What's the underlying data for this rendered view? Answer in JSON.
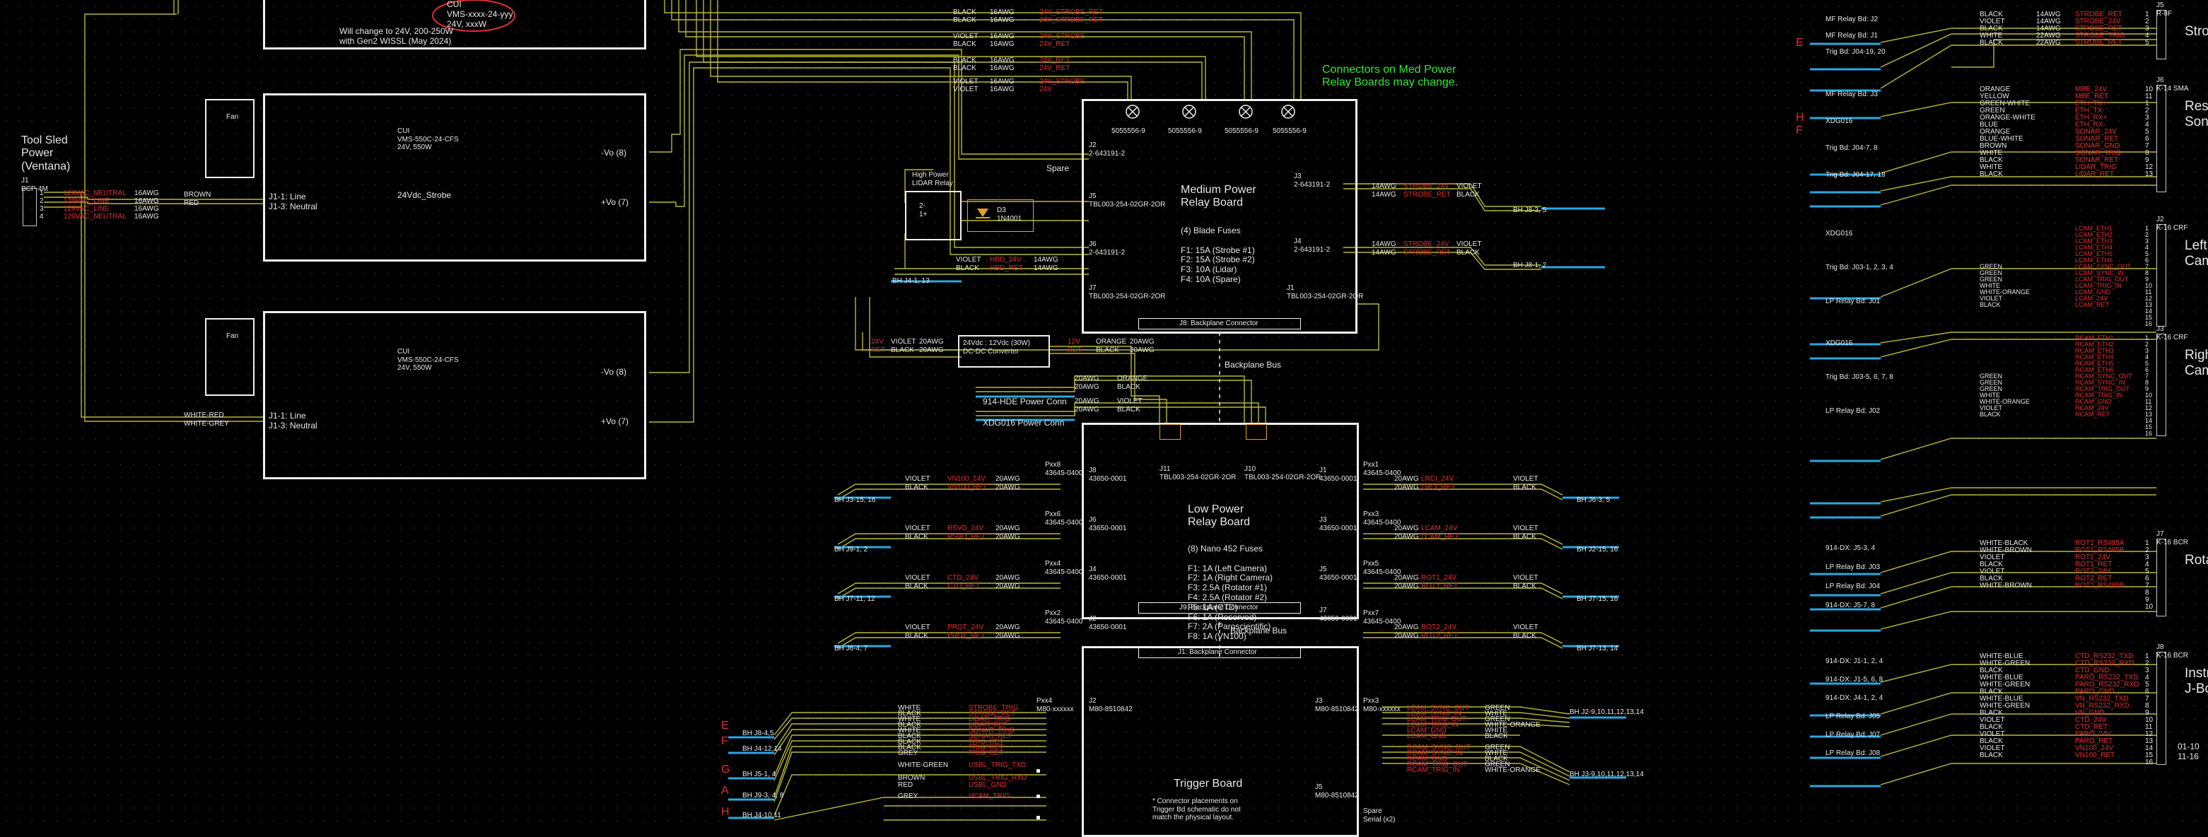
{
  "tool_sled": {
    "title": "Tool Sled\nPower\n(Ventana)",
    "connector": "J1\nBCP-4M"
  },
  "tool_sled_wires": {
    "signals": [
      "120VAC_NEUTRAL",
      "120VAC_LINE",
      "120VAC_LINE",
      "120VAC_NEUTRAL"
    ],
    "gauges": [
      "16AWG",
      "16AWG",
      "16AWG",
      "16AWG"
    ],
    "pins": [
      "1",
      "2",
      "3",
      "4"
    ]
  },
  "note_top": {
    "cui_name": "CUI\nVMS-xxxx-24-yyy\n24V, xxxW",
    "change_text": "Will change to 24V, 200-250W\nwith Gen2 WISSL (May 2024)"
  },
  "psu1": {
    "fan": "Fan",
    "cui": "CUI\nVMS-550C-24-CFS\n24V, 550W",
    "name": "24Vdc_Strobe",
    "j1": "J1-1: Line\nJ1-3: Neutral",
    "vminus": "-Vo (8)",
    "vplus": "+Vo (7)",
    "wire_colors": "BROWN\nRED"
  },
  "psu2": {
    "fan": "Fan",
    "cui": "CUI\nVMS-550C-24-CFS\n24V, 550W",
    "j1": "J1-1: Line\nJ1-3: Neutral",
    "vminus": "-Vo (8)",
    "vplus": "+Vo (7)",
    "wire_colors": "WHITE-RED\nWHITE-GREY"
  },
  "top_bundle": {
    "colors": [
      "BLACK",
      "BLACK",
      "VIOLET",
      "BLACK",
      "BLACK",
      "BLACK",
      "VIOLET",
      "VIOLET"
    ],
    "gauges": [
      "16AWG",
      "16AWG",
      "16AWG",
      "16AWG",
      "16AWG",
      "16AWG",
      "16AWG",
      "16AWG"
    ],
    "signals": [
      "24V_STROBE_RET",
      "24V_STROBE_RET",
      "24V_STROBE",
      "24V_RET",
      "24V_RET",
      "24V_RET",
      "24V_STROBE",
      "24V"
    ]
  },
  "med_note": "Connectors on Med Power\nRelay Boards may change.",
  "mpr": {
    "title": "Medium Power\nRelay Board",
    "connectors": [
      "5055556-9",
      "5055556-9",
      "5055556-9",
      "5055556-9"
    ],
    "fuses": "(4) Blade Fuses\n\nF1: 15A (Strobe #1)\nF2: 15A (Strobe #2)\nF3: 10A (Lidar)\nF4: 10A (Spare)",
    "backplane": "J8: Backplane Connector",
    "spare": "Spare",
    "j_left1": "J2\n2-643191-2",
    "j_left2": "J5\nTBL003-254-02GR-2OR",
    "j_left3": "J6\n2-643191-2",
    "j_left4": "J7\nTBL003-254-02GR-2OR",
    "j_right1": "J3\n2-643191-2",
    "j_right2": "J4\n2-643191-2",
    "j_right3": "J1\nTBL003-254-02GR-2OR"
  },
  "mpr_outputs": {
    "out1": {
      "gauges": "14AWG\n14AWG",
      "signals": "STROBE_24V\nSTROBE_RET",
      "colors": "VIOLET\nBLACK",
      "dest": "BH J8-3, 5"
    },
    "out2": {
      "gauges": "14AWG\n14AWG",
      "signals": "STROBE_24V\nSTROBE_RET",
      "colors": "VIOLET\nBLACK",
      "dest": "BH J8-1, 2"
    }
  },
  "lidar": {
    "title": "High Power\nLIDAR Relay",
    "pins": "2-\n1+",
    "diode": "D3\n1N4001"
  },
  "lidar_wires": {
    "colors": "VIOLET\nBLACK",
    "signals": "HBD_24V\nHBD_RET",
    "gauges": "14AWG\n14AWG",
    "dest": "BH J4-1, 13"
  },
  "dcdc": {
    "label": "24Vdc : 12Vdc (30W)\nDC-DC Converter",
    "left": "24V\nRET",
    "left_colors": "VIOLET\nBLACK",
    "left_gauges": "20AWG\n20AWG",
    "right": "12V\nRET",
    "right_colors": "ORANGE\nBLACK",
    "right_gauges": "20AWG\n20AWG"
  },
  "backplane_bus_1": "Backplane Bus",
  "backplane_bus_2": "Backplane Bus",
  "power_conns": {
    "c1": {
      "label": "914-HDE Power Conn",
      "gauges": "20AWG\n20AWG",
      "colors": "ORANGE\nBLACK"
    },
    "c2": {
      "label": "XDG016 Power Conn",
      "gauges": "20AWG\n20AWG",
      "colors": "VIOLET\nBLACK"
    }
  },
  "lpr": {
    "title": "Low Power\nRelay Board",
    "fuses": "(8) Nano 452 Fuses\n\nF1: 1A (Left Camera)\nF2: 1A (Right Camera)\nF3: 2.5A (Rotator #1)\nF4: 2.5A (Rotator #2)\nF5: 1A (CTD)\nF6: 1A (Reserved)\nF7: 2A (Paroscientific)\nF8: 1A (VN100)",
    "backplane": "J9: Backplane Connector",
    "j11": "J11\nTBL003-254-02GR-2OR",
    "j10": "J10\nTBL003-254-02GR-2OR",
    "left_j": [
      "J8\n43650-0001",
      "J6\n43650-0001",
      "J4\n43650-0001",
      "J2\n43650-0001"
    ],
    "right_j": [
      "J1\n43650-0001",
      "J3\n43650-0001",
      "J5\n43650-0001",
      "J7\n43650-0001"
    ],
    "left_p": [
      "Pxx8\n43645-0400",
      "Pxx6\n43645-0400",
      "Pxx4\n43645-0400",
      "Pxx2\n43645-0400"
    ],
    "right_p": [
      "Pxx1\n43645-0400",
      "Pxx3\n43645-0400",
      "Pxx5\n43645-0400",
      "Pxx7\n43645-0400"
    ]
  },
  "lpr_left": [
    {
      "colors": "VIOLET\nBLACK",
      "signals": "VN100_24V\nVN100_RET",
      "gauges": "20AWG\n20AWG",
      "dest": "BH J3-15, 16"
    },
    {
      "colors": "VIOLET\nBLACK",
      "signals": "RSVD_24V\nRSVD_RET",
      "gauges": "20AWG\n20AWG",
      "dest": "BH J9-1, 2"
    },
    {
      "colors": "VIOLET\nBLACK",
      "signals": "CTD_24V\nCTD_RET",
      "gauges": "20AWG\n20AWG",
      "dest": "BH J7-11, 12"
    },
    {
      "colors": "VIOLET\nBLACK",
      "signals": "PROT_24V\nPROT_RET",
      "gauges": "20AWG\n20AWG",
      "dest": "BH J6-4, 7"
    }
  ],
  "lpr_right": [
    {
      "colors": "VIOLET\nBLACK",
      "signals": "LRCI_24V\nLRCI_RET",
      "gauges": "20AWG\n20AWG",
      "dest": "BH J6-3, 5"
    },
    {
      "colors": "VIOLET\nBLACK",
      "signals": "LCAM_24V\nLCAM_RET",
      "gauges": "20AWG\n20AWG",
      "dest": "BH J2-15, 16"
    },
    {
      "colors": "VIOLET\nBLACK",
      "signals": "ROT1_24V\nROT1_RET",
      "gauges": "20AWG\n20AWG",
      "dest": "BH J7-15, 16"
    },
    {
      "colors": "VIOLET\nBLACK",
      "signals": "ROT2_24V\nROT2_RET",
      "gauges": "20AWG\n20AWG",
      "dest": "BH J7-13, 14"
    }
  ],
  "trigger": {
    "title": "Trigger Board",
    "backplane": "J1: Backplane Connector",
    "note": "* Connector placements on\nTrigger Bd schematic do not\nmatch the physical layout.",
    "j2": "J2\nM80-8510842",
    "j3": "J3\nM80-8510842",
    "j5": "J5\nM80-8510842",
    "pxx4": "Pxx4\nM80-xxxxxx",
    "pxx3": "Pxx3\nM80-xxxxxx",
    "spare": "Spare\nSerial (x2)"
  },
  "trigger_left": {
    "letters": [
      "E",
      "F",
      "G",
      "A",
      "H"
    ],
    "dests": [
      "BH J8-4,5",
      "BH J4-12,14",
      "BH J5-1, 4",
      "BH J9-3, 4, 8",
      "BH J4-10,11"
    ],
    "colors": [
      "WHITE",
      "BLACK",
      "WHITE",
      "BLACK",
      "WHITE",
      "BLACK",
      "BLACK",
      "BLACK",
      "GREY",
      "WHITE-GREEN",
      "BROWN",
      "RED",
      "GREY"
    ],
    "signals": [
      "STROBE_TRIG",
      "STROBE_RET",
      "LIDAR_TRIG",
      "LIDAR_RET",
      "SONAR_TRIG",
      "SONAR_RET",
      "TRIG_RET",
      "TRIG_RET",
      "TRIG_RET",
      "USBL_TRIG_TXD",
      "USBL_TRIG_RXD",
      "USBL_GND",
      "VCAM_TRIG"
    ]
  },
  "trigger_right": {
    "dests": [
      "BH J2-9,10,11,12,13,14",
      "BH J3-9,10,11,12,13,14"
    ],
    "colors": [
      "GREEN",
      "WHITE",
      "GREEN",
      "WHITE-ORANGE",
      "WHITE",
      "BLACK",
      "GREEN",
      "WHITE",
      "BLACK",
      "GREEN",
      "WHITE-ORANGE"
    ],
    "signals": [
      "LCAM_SYNC_OUT",
      "LCAM_SYNC_IN",
      "LCAM_TRIG_OUT",
      "LCAM_TRIG_IN",
      "LCAM_GND",
      "LCAM_GND",
      "RCAM_SYNC_OUT",
      "RCAM_SYNC_IN",
      "RCAM_GND",
      "RCAM_TRIG_OUT",
      "RCAM_TRIG_IN"
    ]
  },
  "right_panel": {
    "sections": [
      {
        "title": "Strob",
        "connector": "J5\nR-8F",
        "srcs": [
          "MF Relay Bd: J2",
          "MF Relay Bd: J1",
          "Trig Bd: J04-19, 20"
        ],
        "letter": "E",
        "colors": [
          "BLACK",
          "VIOLET",
          "BLACK",
          "WHITE",
          "BLACK"
        ],
        "gauges": [
          "14AWG",
          "14AWG",
          "14AWG",
          "22AWG",
          "22AWG"
        ],
        "signals": [
          "STROBE_RET",
          "STROBE_24V",
          "STROBE_RET",
          "STROBE_TRIG",
          "STROBE_RET"
        ],
        "pins": [
          "1",
          "2",
          "3",
          "4",
          "5"
        ]
      },
      {
        "title": "Reso\nSona",
        "connector": "J6\nK-14 SMA",
        "srcs": [
          "MF Relay Bd: J3",
          "XDG016",
          "Trig Bd: J04-7, 8",
          "Trig Bd: J04-17, 18"
        ],
        "letter": "H\nF",
        "colors": [
          "ORANGE",
          "YELLOW",
          "GREEN-WHITE",
          "GREEN",
          "ORANGE-WHITE",
          "BLUE",
          "ORANGE",
          "BLUE-WHITE",
          "BROWN",
          "WHITE",
          "BLACK",
          "WHITE",
          "BLACK"
        ],
        "signals": [
          "MBE_24V",
          "MBE_RET",
          "ETH_TX+",
          "ETH_TX-",
          "ETH_RX+",
          "ETH_RX-",
          "SONAR_24V",
          "SONAR_RET",
          "SONAR_GND",
          "SONAR_TRIG",
          "SONAR_RET",
          "LIDAR_TRIG",
          "LIDAR_RET"
        ],
        "pins": [
          "10",
          "11",
          "1",
          "2",
          "3",
          "4",
          "5",
          "6",
          "7",
          "8",
          "9",
          "12",
          "13"
        ]
      },
      {
        "title": "Left\nCam",
        "connector": "J2\nK-16 CRF",
        "srcs": [
          "XDG016",
          "Trig Bd: J03-1, 2, 3, 4",
          "LP Relay Bd: J01"
        ],
        "letter": "",
        "colors": [
          "",
          "",
          "",
          "",
          "",
          "",
          "GREEN",
          "GREEN",
          "GREEN",
          "WHITE",
          "WHITE-ORANGE",
          "VIOLET",
          "BLACK"
        ],
        "signals": [
          "LCAM_ETH1",
          "LCAM_ETH2",
          "LCAM_ETH3",
          "LCAM_ETH4",
          "LCAM_ETH5",
          "LCAM_ETH6",
          "LCAM_SYNC_OUT",
          "LCAM_SYNC_IN",
          "LCAM_TRIG_OUT",
          "LCAM_TRIG_IN",
          "LCAM_GND",
          "LCAM_24V",
          "LCAM_RET"
        ],
        "pins": [
          "1",
          "2",
          "3",
          "4",
          "5",
          "6",
          "7",
          "8",
          "9",
          "10",
          "11",
          "12",
          "13",
          "14",
          "15",
          "16"
        ]
      },
      {
        "title": "Righ\nCam",
        "connector": "J3\nK-16 CRF",
        "srcs": [
          "XDG016",
          "Trig Bd: J03-5, 6, 7, 8",
          "LP Relay Bd: J02"
        ],
        "letter": "",
        "colors": [
          "",
          "",
          "",
          "",
          "",
          "",
          "GREEN",
          "GREEN",
          "GREEN",
          "WHITE",
          "WHITE-ORANGE",
          "VIOLET",
          "BLACK"
        ],
        "signals": [
          "RCAM_ETH1",
          "RCAM_ETH2",
          "RCAM_ETH3",
          "RCAM_ETH4",
          "RCAM_ETH5",
          "RCAM_ETH6",
          "RCAM_SYNC_OUT",
          "RCAM_SYNC_IN",
          "RCAM_TRIG_OUT",
          "RCAM_TRIG_IN",
          "RCAM_GND",
          "RCAM_24V",
          "RCAM_RET"
        ],
        "pins": [
          "1",
          "2",
          "3",
          "4",
          "5",
          "6",
          "7",
          "8",
          "9",
          "10",
          "11",
          "12",
          "13",
          "14",
          "15",
          "16"
        ]
      },
      {
        "title": "Rota",
        "connector": "J7\nK-16 BCR",
        "srcs": [
          "914-DX: J5-3, 4",
          "LP Relay Bd: J03",
          "LP Relay Bd: J04",
          "914-DX: J5-7, 8"
        ],
        "letter": "",
        "colors": [
          "WHITE-BLACK",
          "WHITE-BROWN",
          "VIOLET",
          "BLACK",
          "VIOLET",
          "BLACK",
          "WHITE-BROWN"
        ],
        "signals": [
          "ROT1_RS485A",
          "ROT1_RS485B",
          "ROT1_24V",
          "ROT1_RET",
          "ROT2_24V",
          "ROT2_RET",
          "ROT2_RS485B"
        ],
        "pins": [
          "1",
          "2",
          "3",
          "4",
          "5",
          "6",
          "7",
          "8",
          "9",
          "10"
        ]
      },
      {
        "title": "Instru\nJ-Bo",
        "connector": "J8\nK-16 BCR",
        "srcs": [
          "914-DX: J1-1, 2, 4",
          "914-DX: J1-5, 6, 8",
          "914-DX: J4-1, 2, 4",
          "LP Relay Bd: J05",
          "LP Relay Bd: J07",
          "LP Relay Bd: J08"
        ],
        "letter": "",
        "colors": [
          "WHITE-BLUE",
          "WHITE-GREEN",
          "BLACK",
          "WHITE-BLUE",
          "WHITE-GREEN",
          "BLACK",
          "WHITE-BLUE",
          "WHITE-GREEN",
          "BLACK",
          "VIOLET",
          "BLACK",
          "VIOLET",
          "BLACK",
          "VIOLET",
          "BLACK"
        ],
        "signals": [
          "CTD_RS232_TXD",
          "CTD_RS232_RXD",
          "CTD_GND",
          "PARO_RS232_TXD",
          "PARO_RS232_RXD",
          "PARO_GND",
          "VN_RS232_TXD",
          "VN_RS232_RXD",
          "VN_GND",
          "CTD_24V",
          "CTD_RET",
          "PARO_24V",
          "PARO_RET",
          "VN100_24V",
          "VN100_RET"
        ],
        "pins": [
          "1",
          "2",
          "3",
          "4",
          "5",
          "6",
          "7",
          "8",
          "9",
          "10",
          "11",
          "12",
          "13",
          "14",
          "15",
          "16"
        ],
        "extra": "01-10\n11-16"
      }
    ]
  },
  "colors": {
    "background": "#000000",
    "wire": "#b8b83a",
    "box": "#f0f0f0",
    "signal": "#e03030",
    "note": "#32e632",
    "dest": "#29a8e0"
  }
}
